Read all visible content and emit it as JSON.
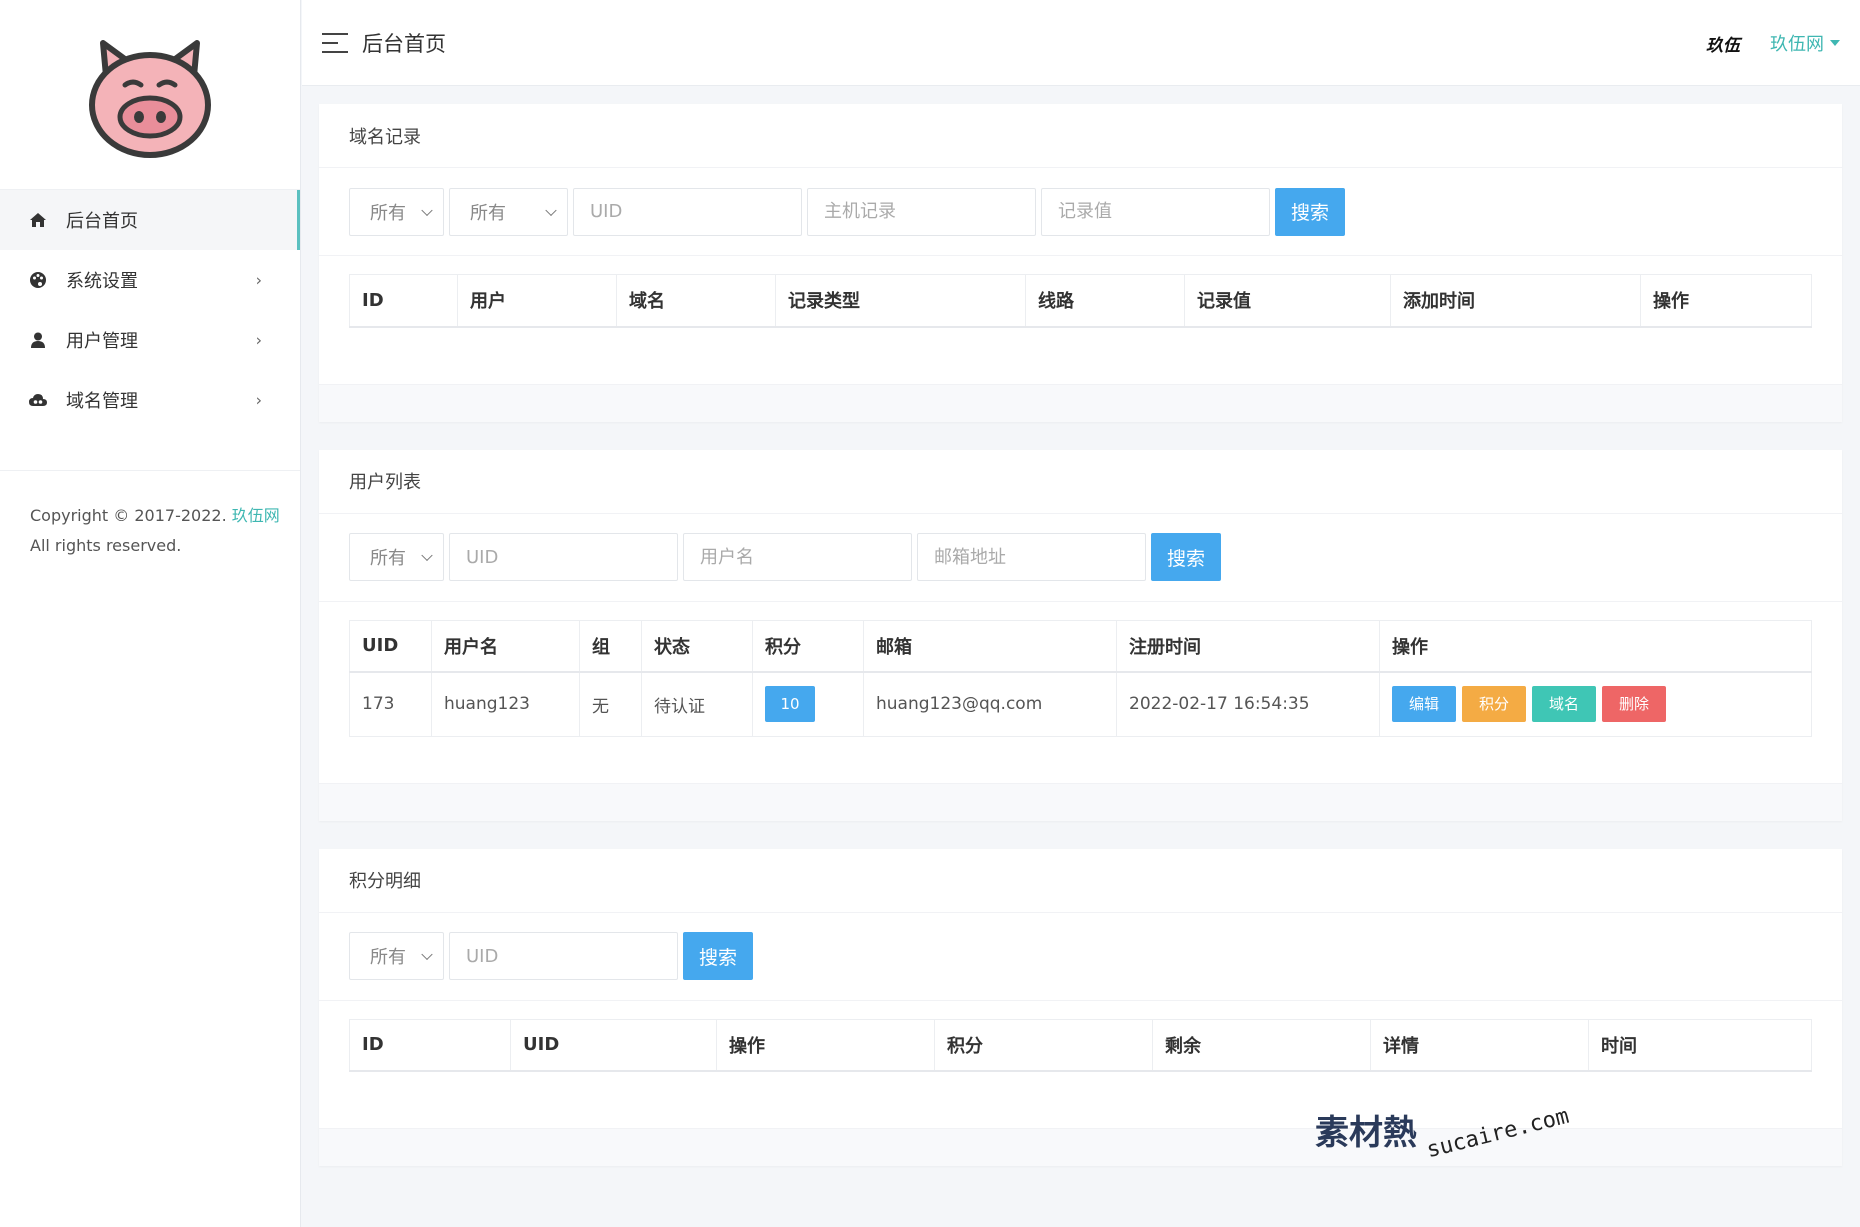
{
  "app": {
    "header_title": "后台首页",
    "user_name": "玖伍",
    "site_name": "玖伍网"
  },
  "sidebar": {
    "items": [
      {
        "label": "后台首页",
        "icon": "home-icon"
      },
      {
        "label": "系统设置",
        "icon": "palette-icon"
      },
      {
        "label": "用户管理",
        "icon": "user-icon"
      },
      {
        "label": "域名管理",
        "icon": "cloud-icon"
      }
    ],
    "copyright_prefix": "Copyright © 2017-2022.",
    "copyright_brand": "玖伍网",
    "copyright_suffix": "All rights reserved."
  },
  "domain_panel": {
    "title": "域名记录",
    "filter": {
      "select1": "所有",
      "select2": "所有",
      "uid_placeholder": "UID",
      "host_placeholder": "主机记录",
      "value_placeholder": "记录值",
      "search_label": "搜索"
    },
    "columns": [
      "ID",
      "用户",
      "域名",
      "记录类型",
      "线路",
      "记录值",
      "添加时间",
      "操作"
    ]
  },
  "user_panel": {
    "title": "用户列表",
    "filter": {
      "select1": "所有",
      "uid_placeholder": "UID",
      "username_placeholder": "用户名",
      "email_placeholder": "邮箱地址",
      "search_label": "搜索"
    },
    "columns": [
      "UID",
      "用户名",
      "组",
      "状态",
      "积分",
      "邮箱",
      "注册时间",
      "操作"
    ],
    "rows": [
      {
        "uid": "173",
        "username": "huang123",
        "group": "无",
        "status": "待认证",
        "score": "10",
        "email": "huang123@qq.com",
        "registered": "2022-02-17 16:54:35",
        "actions": {
          "edit": "编辑",
          "score": "积分",
          "domain": "域名",
          "delete": "删除"
        }
      }
    ]
  },
  "score_panel": {
    "title": "积分明细",
    "filter": {
      "select1": "所有",
      "uid_placeholder": "UID",
      "search_label": "搜索"
    },
    "columns": [
      "ID",
      "UID",
      "操作",
      "积分",
      "剩余",
      "详情",
      "时间"
    ]
  },
  "watermark": {
    "cn": "素材熱",
    "en": "sucaire.com"
  },
  "colors": {
    "accent": "#3fb7b2",
    "primary": "#45a8ee",
    "warning": "#f4ab44",
    "success": "#3fc6b5",
    "danger": "#ee6666"
  }
}
